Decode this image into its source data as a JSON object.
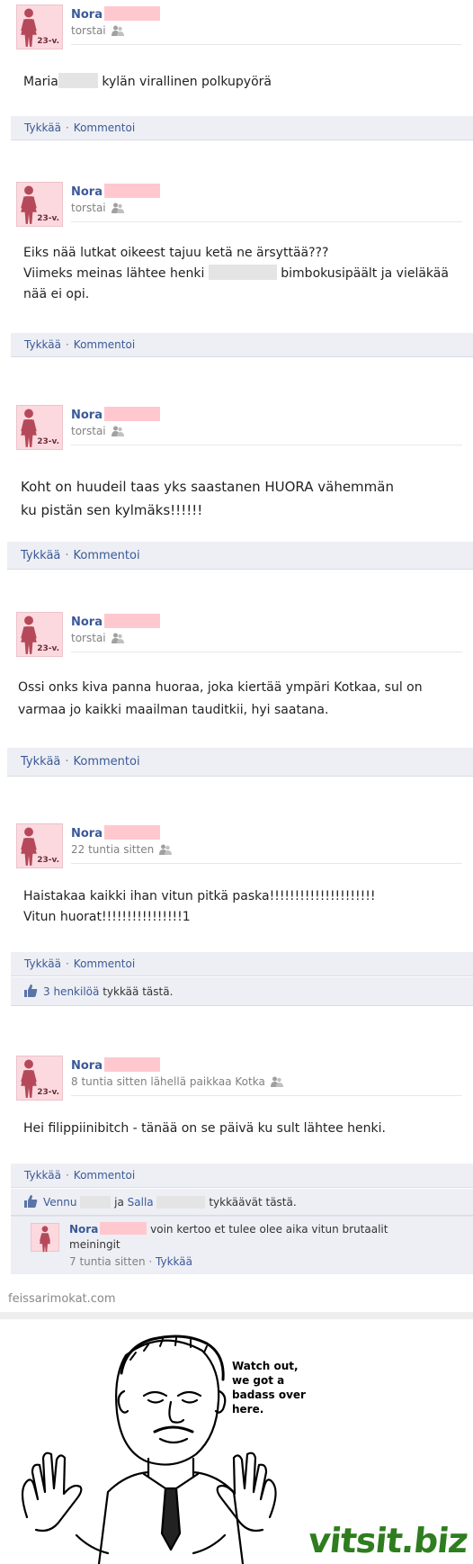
{
  "posts": [
    {
      "name": "Nora",
      "age": "23-v.",
      "time": "torstai",
      "text_lines": [
        [
          "Maria",
          "kylän virallinen polkupyörä"
        ]
      ],
      "like_label": "Tykkää",
      "comment_label": "Kommentoi"
    },
    {
      "name": "Nora",
      "age": "23-v.",
      "time": "torstai",
      "text": {
        "line1": "Eiks nää lutkat oikeest tajuu ketä ne ärsyttää???",
        "line2a": "Viimeks meinas lähtee henki",
        "line2b": "bimbokusipäält ja vieläkää",
        "line3": "nää ei opi."
      },
      "like_label": "Tykkää",
      "comment_label": "Kommentoi"
    },
    {
      "name": "Nora",
      "age": "23-v.",
      "time": "torstai",
      "text": {
        "line1": "Koht on huudeil taas yks saastanen HUORA vähemmän",
        "line2": "ku pistän sen kylmäks!!!!!!"
      },
      "like_label": "Tykkää",
      "comment_label": "Kommentoi"
    },
    {
      "name": "Nora",
      "age": "23-v.",
      "time": "torstai",
      "text": {
        "line1": "Ossi onks kiva panna huoraa, joka kiertää ympäri Kotkaa, sul on",
        "line2": "varmaa jo kaikki maailman tauditkii, hyi saatana."
      },
      "like_label": "Tykkää",
      "comment_label": "Kommentoi"
    },
    {
      "name": "Nora",
      "age": "23-v.",
      "time": "22 tuntia sitten",
      "text": {
        "line1": "Haistakaa kaikki ihan vitun pitkä paska!!!!!!!!!!!!!!!!!!!!!",
        "line2": "Vitun huorat!!!!!!!!!!!!!!!!1"
      },
      "like_label": "Tykkää",
      "comment_label": "Kommentoi",
      "likes": {
        "link": "3 henkilöä",
        "rest": "tykkää tästä."
      }
    },
    {
      "name": "Nora",
      "age": "23-v.",
      "time": "8 tuntia sitten lähellä paikkaa Kotka",
      "text": {
        "line1": "Hei filippiinibitch - tänää on se päivä ku sult lähtee henki."
      },
      "like_label": "Tykkää",
      "comment_label": "Kommentoi",
      "likes": {
        "name1": "Vennu",
        "and": "ja",
        "name2": "Salla",
        "rest": "tykkäävät tästä."
      },
      "comment": {
        "name": "Nora",
        "text": "voin kertoo et tulee olee aika vitun brutaalit meiningit",
        "time": "7 tuntia sitten",
        "like_label": "Tykkää"
      }
    }
  ],
  "watermark": "feissarimokat.com",
  "meme": {
    "line1": "Watch out,",
    "line2": "we got a",
    "line3": "badass over",
    "line4": "here."
  },
  "logo": "vitsit.biz"
}
